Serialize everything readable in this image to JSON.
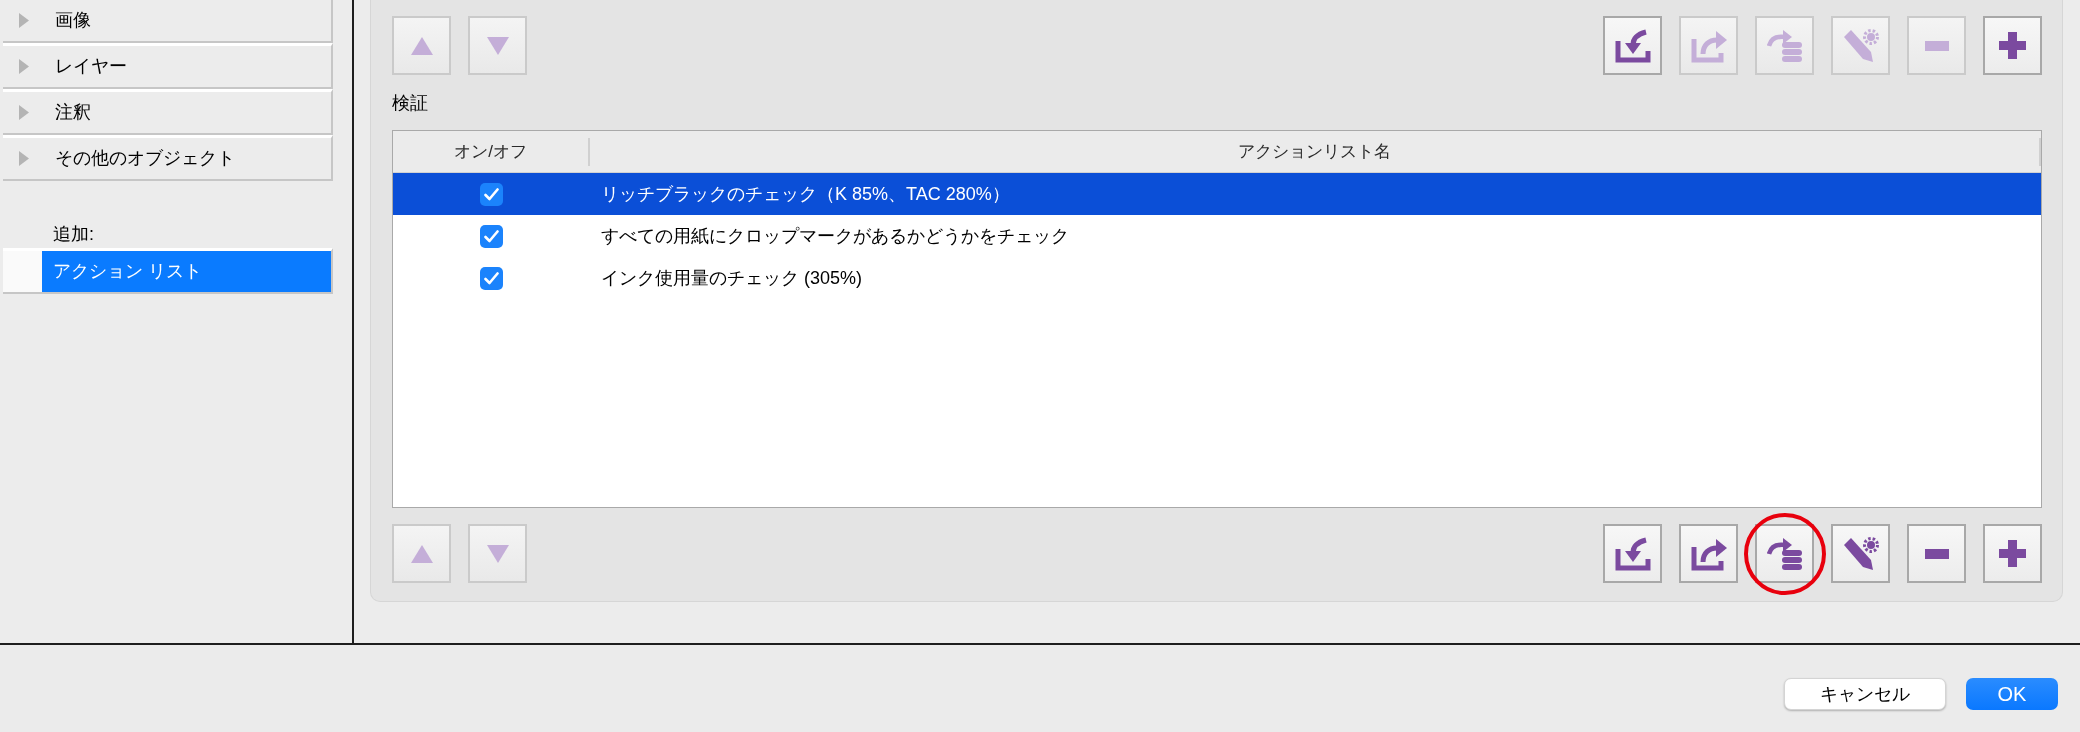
{
  "sidebar": {
    "items": [
      {
        "label": "画像",
        "expanded": false
      },
      {
        "label": "レイヤー",
        "expanded": false
      },
      {
        "label": "注釈",
        "expanded": false
      },
      {
        "label": "その他のオブジェクト",
        "expanded": false
      }
    ],
    "add_label": "追加:",
    "add_items": [
      {
        "label": "アクション リスト",
        "selected": true
      }
    ]
  },
  "top_toolbar": {
    "move_buttons": [
      {
        "kind": "up",
        "disabled": true
      },
      {
        "kind": "down",
        "disabled": true
      }
    ],
    "buttons": [
      {
        "kind": "import",
        "disabled": false
      },
      {
        "kind": "export",
        "disabled": true
      },
      {
        "kind": "send_to_stack",
        "disabled": true
      },
      {
        "kind": "edit_settings",
        "disabled": true
      },
      {
        "kind": "remove",
        "disabled": true
      },
      {
        "kind": "add",
        "disabled": false
      }
    ]
  },
  "section_title": "検証",
  "table": {
    "columns": [
      "オン/オフ",
      "アクションリスト名"
    ],
    "rows": [
      {
        "checked": true,
        "name": "リッチブラックのチェック（K 85%、TAC 280%）",
        "selected": true
      },
      {
        "checked": true,
        "name": "すべての用紙にクロップマークがあるかどうかをチェック",
        "selected": false
      },
      {
        "checked": true,
        "name": "インク使用量のチェック (305%)",
        "selected": false
      }
    ]
  },
  "bottom_toolbar": {
    "move_buttons": [
      {
        "kind": "up",
        "disabled": true
      },
      {
        "kind": "down",
        "disabled": true
      }
    ],
    "buttons": [
      {
        "kind": "import",
        "disabled": false,
        "circled": false
      },
      {
        "kind": "export",
        "disabled": false,
        "circled": false
      },
      {
        "kind": "send_to_stack",
        "disabled": false,
        "circled": true
      },
      {
        "kind": "edit_settings",
        "disabled": false,
        "circled": false
      },
      {
        "kind": "remove",
        "disabled": false,
        "circled": false
      },
      {
        "kind": "add",
        "disabled": false,
        "circled": false
      }
    ]
  },
  "footer": {
    "buttons": [
      {
        "label": "キャンセル",
        "kind": "secondary"
      },
      {
        "label": "OK",
        "kind": "primary"
      }
    ]
  }
}
